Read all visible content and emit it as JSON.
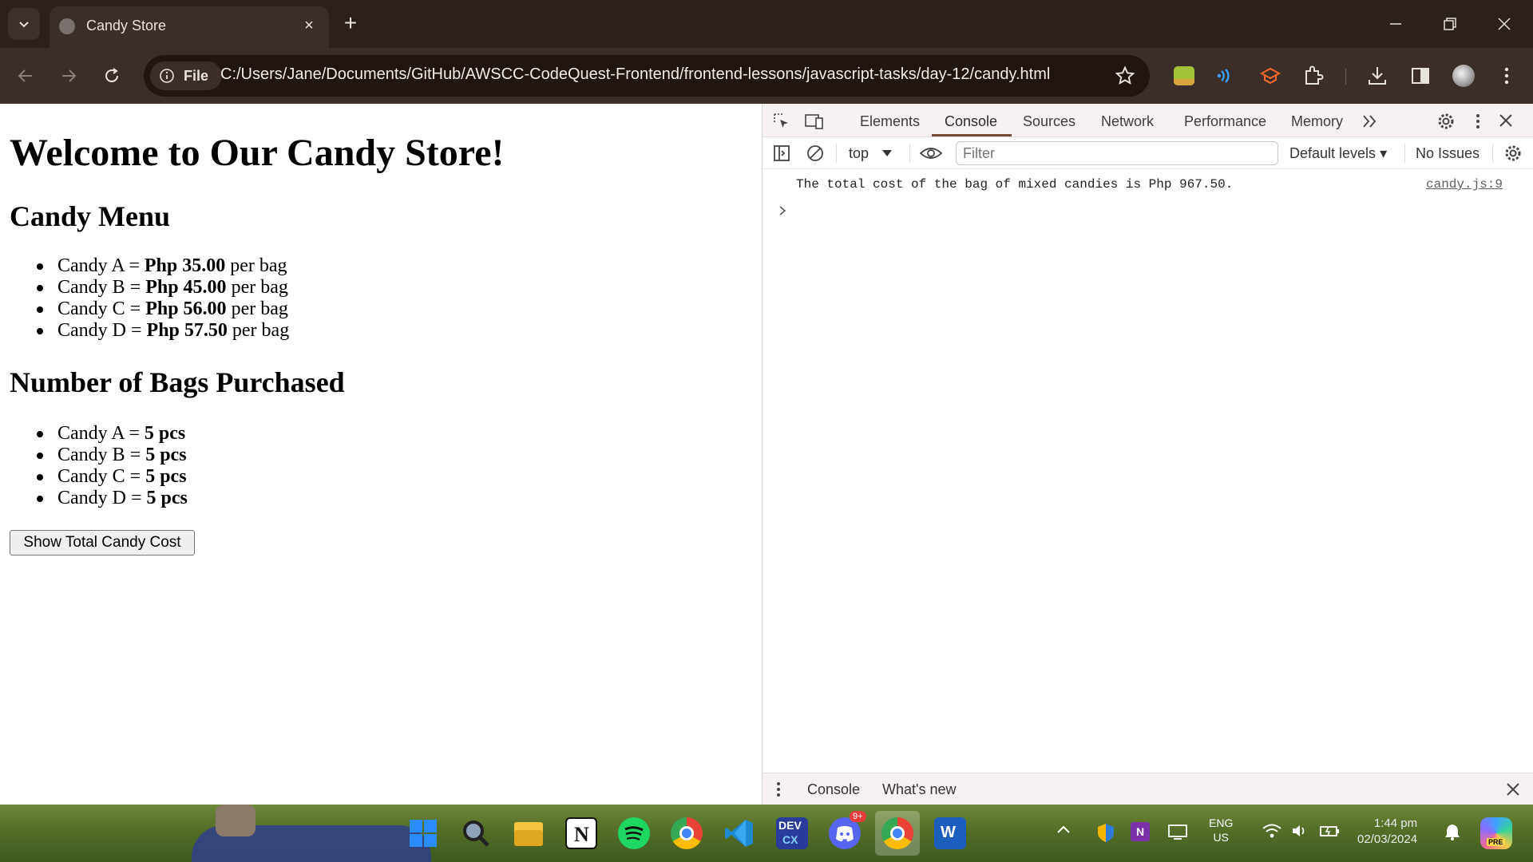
{
  "browser": {
    "tab_title": "Candy Store",
    "file_chip": "File",
    "url": "C:/Users/Jane/Documents/GitHub/AWSCC-CodeQuest-Frontend/frontend-lessons/javascript-tasks/day-12/candy.html"
  },
  "page": {
    "heading": "Welcome to Our Candy Store!",
    "menu_title": "Candy Menu",
    "menu_items": [
      {
        "name": "Candy A = ",
        "price": "Php 35.00",
        "unit": " per bag"
      },
      {
        "name": "Candy B = ",
        "price": "Php 45.00",
        "unit": " per bag"
      },
      {
        "name": "Candy C = ",
        "price": "Php 56.00",
        "unit": " per bag"
      },
      {
        "name": "Candy D = ",
        "price": "Php 57.50",
        "unit": " per bag"
      }
    ],
    "bags_title": "Number of Bags Purchased",
    "bags_items": [
      {
        "name": "Candy A = ",
        "qty": "5 pcs"
      },
      {
        "name": "Candy B = ",
        "qty": "5 pcs"
      },
      {
        "name": "Candy C = ",
        "qty": "5 pcs"
      },
      {
        "name": "Candy D = ",
        "qty": "5 pcs"
      }
    ],
    "button_label": "Show Total Candy Cost"
  },
  "devtools": {
    "tabs": [
      "Elements",
      "Console",
      "Sources",
      "Network",
      "Performance",
      "Memory"
    ],
    "context": "top",
    "filter_placeholder": "Filter",
    "levels": "Default levels",
    "issues": "No Issues",
    "log_message": "The total cost of the bag of mixed candies is Php 967.50.",
    "log_source": "candy.js:9",
    "drawer_tabs": [
      "Console",
      "What's new"
    ]
  },
  "taskbar": {
    "badge": "9+",
    "lang_line1": "ENG",
    "lang_line2": "US",
    "time": "1:44 pm",
    "date": "02/03/2024",
    "word_label": "W",
    "devcx_label": "DEV",
    "pre_label": "PRE"
  }
}
